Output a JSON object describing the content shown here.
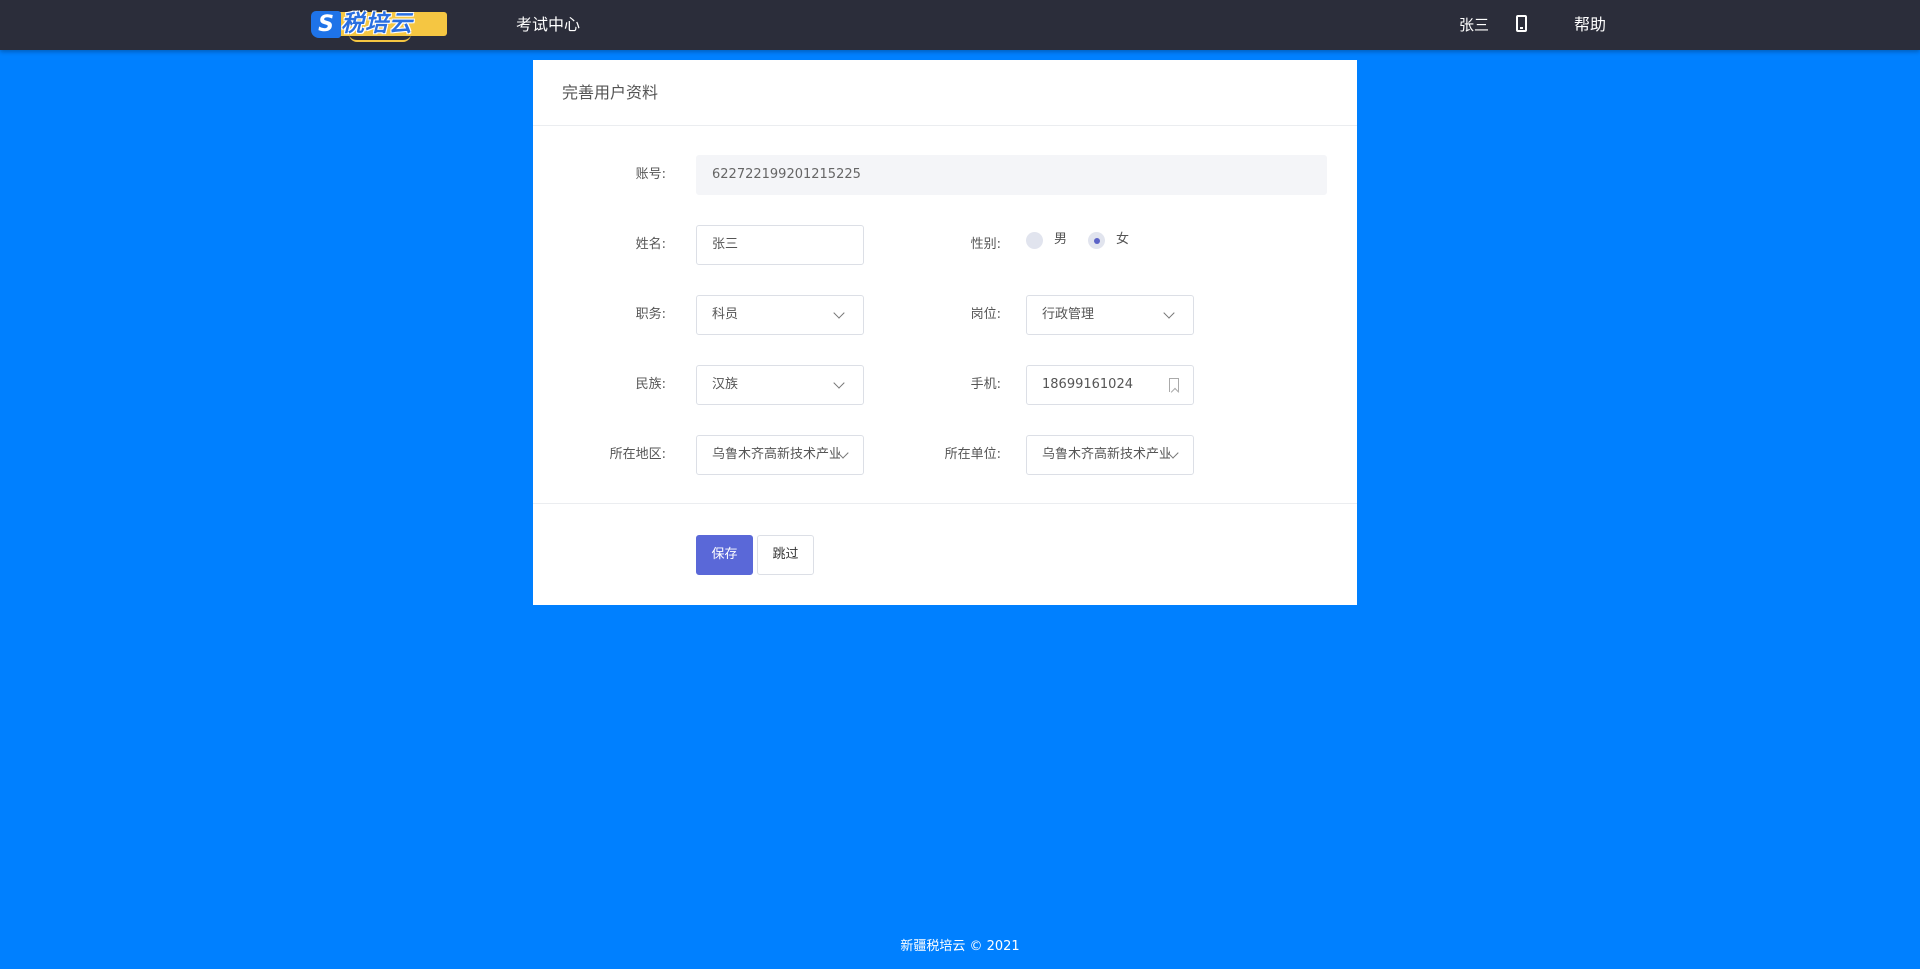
{
  "header": {
    "logo_text": "税培云",
    "nav_exam": "考试中心",
    "user_name": "张三",
    "help": "帮助"
  },
  "card": {
    "title": "完善用户资料"
  },
  "form": {
    "account": {
      "label": "账号:",
      "value": "622722199201215225"
    },
    "name": {
      "label": "姓名:",
      "value": "张三"
    },
    "gender": {
      "label": "性别:",
      "options": [
        "男",
        "女"
      ],
      "selected": "女"
    },
    "duty": {
      "label": "职务:",
      "value": "科员"
    },
    "post": {
      "label": "岗位:",
      "value": "行政管理"
    },
    "ethnic": {
      "label": "民族:",
      "value": "汉族"
    },
    "mobile": {
      "label": "手机:",
      "value": "18699161024"
    },
    "region": {
      "label": "所在地区:",
      "value": "乌鲁木齐高新技术产业"
    },
    "unit": {
      "label": "所在单位:",
      "value": "乌鲁木齐高新技术产业"
    }
  },
  "actions": {
    "save": "保存",
    "skip": "跳过"
  },
  "footer": {
    "text": "新疆税培云 © 2021"
  },
  "colors": {
    "page_bg": "#0080ff",
    "topbar_bg": "#2b2d3a",
    "primary_button": "#5a68d8"
  }
}
